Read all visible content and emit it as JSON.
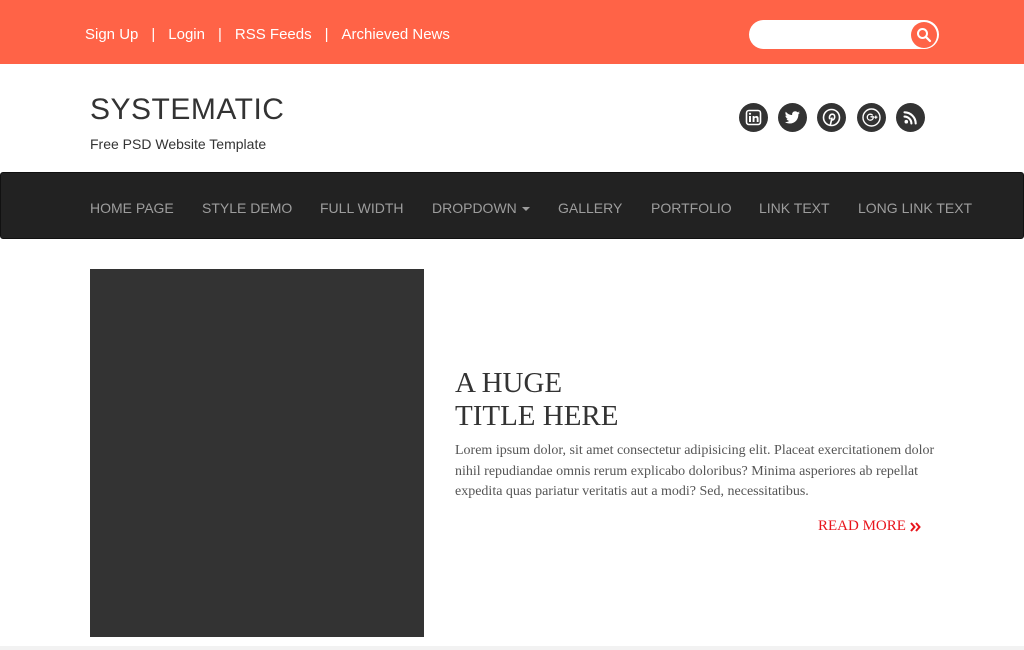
{
  "topbar": {
    "links": [
      "Sign Up",
      "Login",
      "RSS Feeds",
      "Archieved News"
    ],
    "separator": "|",
    "search": {
      "placeholder": "",
      "icon": "search-icon"
    },
    "colors": {
      "background": "#ff6347",
      "text": "#ffffff"
    }
  },
  "header": {
    "brand": "SYSTEMATIC",
    "tagline": "Free PSD Website Template",
    "social_icons": [
      "linkedin-icon",
      "twitter-icon",
      "pinterest-icon",
      "google-plus-icon",
      "rss-icon"
    ]
  },
  "nav": {
    "items": [
      "HOME PAGE",
      "STYLE DEMO",
      "FULL WIDTH",
      "DROPDOWN",
      "GALLERY",
      "PORTFOLIO",
      "LINK TEXT",
      "LONG LINK TEXT"
    ],
    "colors": {
      "background": "#222222",
      "text": "#9d9d9d"
    }
  },
  "content": {
    "title_line1": "A HUGE",
    "title_line2": "TITLE HERE",
    "paragraph": "Lorem ipsum dolor, sit amet consectetur adipisicing elit. Placeat exercitationem dolor nihil repudiandae omnis rerum explicabo doloribus? Minima asperiores ab repellat expedita quas pariatur veritatis aut a modi? Sed, necessitatibus.",
    "read_more": "READ MORE",
    "read_more_color": "#e8141b",
    "image_color": "#333333"
  }
}
